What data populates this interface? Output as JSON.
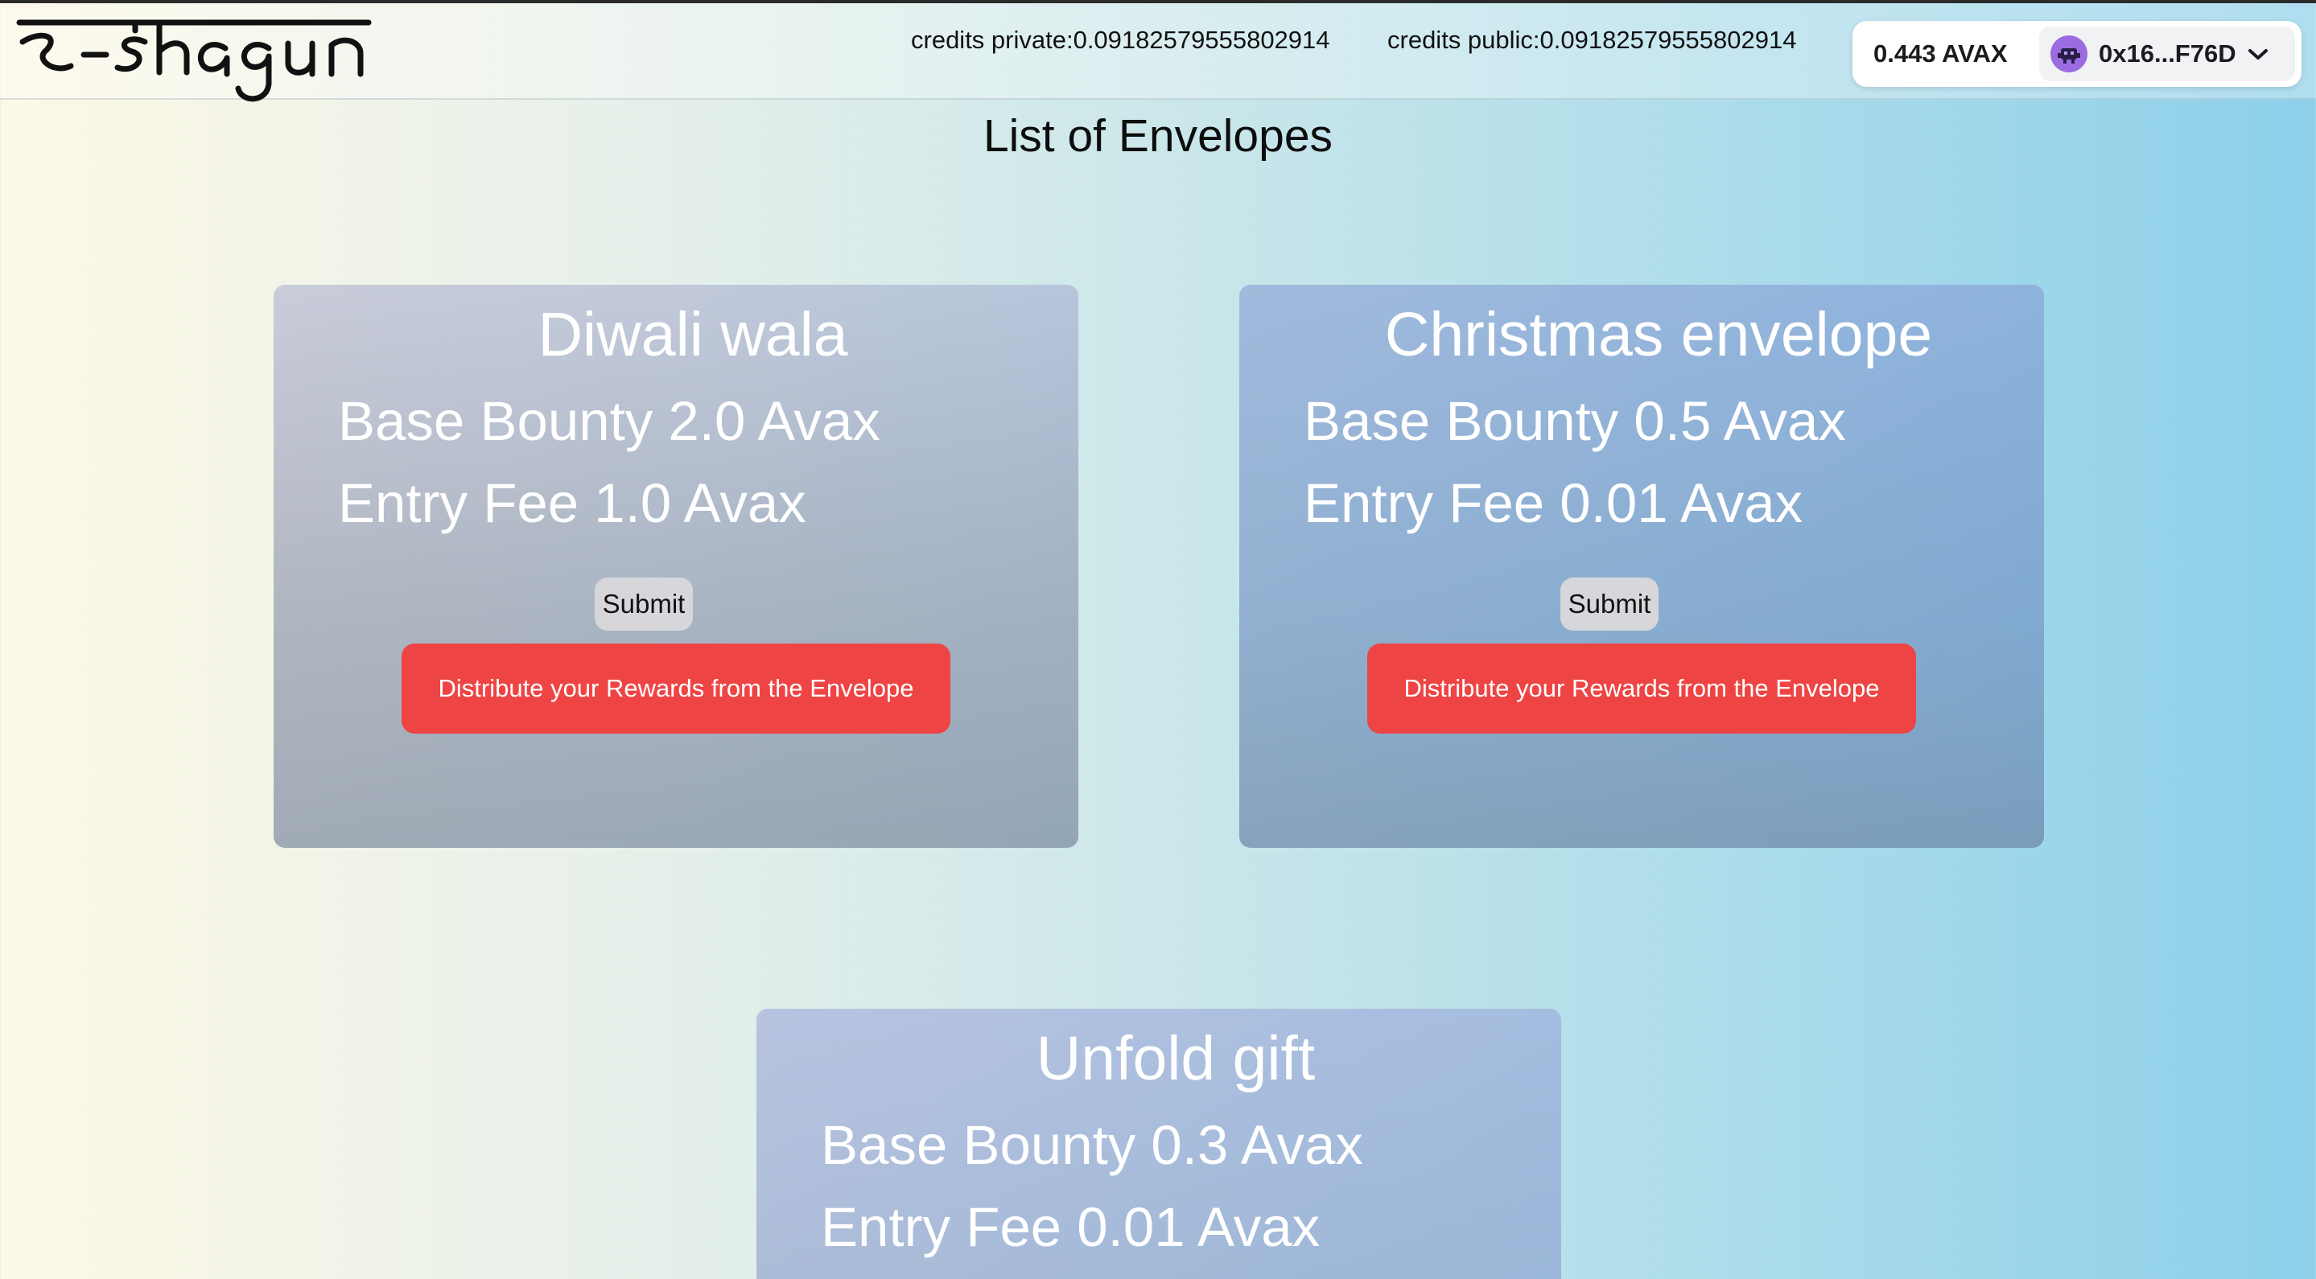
{
  "header": {
    "logo_text": "e-shagun",
    "credits_private": "credits private:0.09182579555802914",
    "credits_public": "credits public:0.09182579555802914",
    "wallet": {
      "balance": "0.443 AVAX",
      "address": "0x16...F76D",
      "avatar_icon": "alien-monster-icon",
      "avatar_color": "#9b6ce0"
    }
  },
  "main": {
    "title": "List of Envelopes",
    "envelopes": [
      {
        "name": "Diwali wala",
        "bounty": "Base Bounty 2.0 Avax",
        "fee": "Entry Fee 1.0 Avax",
        "submit_label": "Submit",
        "distribute_label": "Distribute your Rewards from the Envelope"
      },
      {
        "name": "Christmas envelope",
        "bounty": "Base Bounty 0.5 Avax",
        "fee": "Entry Fee 0.01 Avax",
        "submit_label": "Submit",
        "distribute_label": "Distribute your Rewards from the Envelope"
      },
      {
        "name": "Unfold gift",
        "bounty": "Base Bounty 0.3 Avax",
        "fee": "Entry Fee 0.01 Avax"
      }
    ]
  },
  "colors": {
    "distribute_button": "#ef4444",
    "submit_button": "#d7d7db"
  }
}
